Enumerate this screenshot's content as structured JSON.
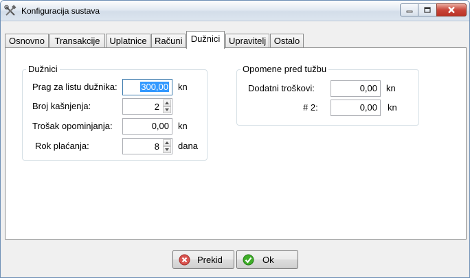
{
  "window": {
    "title": "Konfiguracija sustava",
    "controls": {
      "minimize_icon": "minimize-icon",
      "maximize_icon": "maximize-icon",
      "close_icon": "close-icon"
    }
  },
  "tabs": [
    {
      "label": "Osnovno",
      "active": false
    },
    {
      "label": "Transakcije",
      "active": false
    },
    {
      "label": "Uplatnice",
      "active": false
    },
    {
      "label": "Računi",
      "active": false
    },
    {
      "label": "Dužnici",
      "active": true
    },
    {
      "label": "Upravitelj",
      "active": false
    },
    {
      "label": "Ostalo",
      "active": false
    }
  ],
  "duznici": {
    "title": "Dužnici",
    "prag": {
      "label": "Prag za listu dužnika:",
      "value": "300,00",
      "unit": "kn"
    },
    "broj": {
      "label": "Broj kašnjenja:",
      "value": "2"
    },
    "trosak": {
      "label": "Trošak opominjanja:",
      "value": "0,00",
      "unit": "kn"
    },
    "rok": {
      "label": "Rok plaćanja:",
      "value": "8",
      "unit": "dana"
    }
  },
  "opomene": {
    "title": "Opomene pred tužbu",
    "dodatni": {
      "label": "Dodatni troškovi:",
      "value": "0,00",
      "unit": "kn"
    },
    "broj2": {
      "label": "# 2:",
      "value": "0,00",
      "unit": "kn"
    }
  },
  "buttons": {
    "cancel": {
      "label": "Prekid",
      "icon": "cancel-icon",
      "color": "#d9534f"
    },
    "ok": {
      "label": "Ok",
      "icon": "ok-icon",
      "color": "#3fae29"
    }
  }
}
